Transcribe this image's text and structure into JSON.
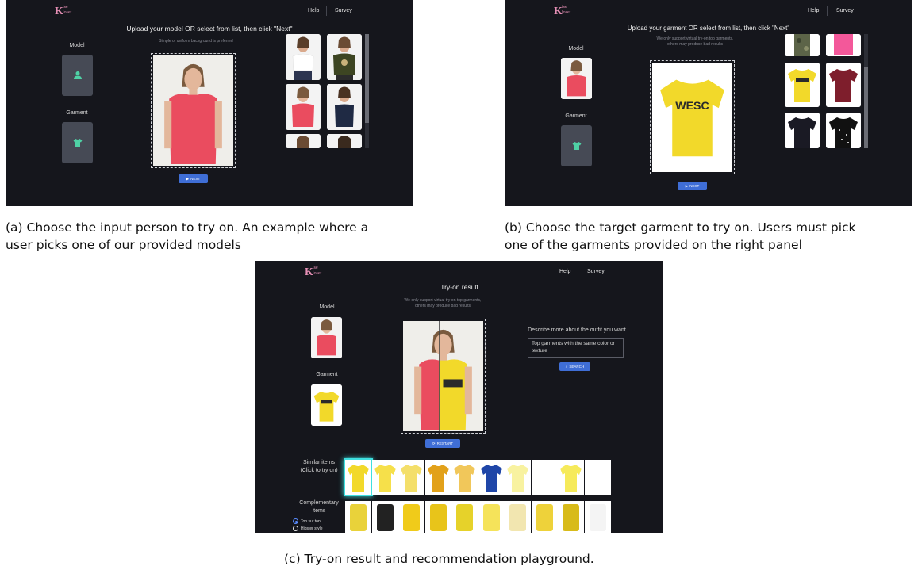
{
  "app": {
    "logo_big": "K",
    "logo_top": "ise",
    "logo_bottom": "loset"
  },
  "nav": {
    "help": "Help",
    "survey": "Survey"
  },
  "panel_a": {
    "title": "Upload your model OR select from list, then click \"Next\"",
    "hint": "Simple or uniform background is preferred",
    "model_label": "Model",
    "garment_label": "Garment",
    "next_label": "NEXT"
  },
  "panel_b": {
    "title": "Upload your garment OR select from list, then click \"Next\"",
    "hint_line1": "We only support virtual try-on top garments,",
    "hint_line2": "others may produce bad results",
    "model_label": "Model",
    "garment_label": "Garment",
    "next_label": "NEXT",
    "garment_print": "WESC"
  },
  "panel_c": {
    "title": "Try-on result",
    "hint_line1": "We only support virtual try-on top garments,",
    "hint_line2": "others may produce bad results",
    "model_label": "Model",
    "garment_label": "Garment",
    "restart_label": "RESTART",
    "describe_label": "Describe more about the outfit you want",
    "describe_value": "Top garments with the same color or texture",
    "search_label": "SEARCH",
    "similar_label_1": "Similar items",
    "similar_label_2": "(Click to try on)",
    "complementary_label_1": "Complementary",
    "complementary_label_2": "items",
    "radio_options": [
      "Ton sur ton",
      "Hipster style"
    ],
    "radio_selected": "Ton sur ton"
  },
  "captions": {
    "a_line1": "(a) Choose the input person to try on. An example where a",
    "a_line2": "user picks one of our provided models",
    "b_line1": "(b) Choose the target garment to try on. Users must pick",
    "b_line2": "one of the garments provided on the right panel",
    "c": "(c) Try-on result and recommendation playground."
  },
  "colors": {
    "background": "#15161c",
    "accent_blue": "#3f6ed6",
    "logo_pink": "#e58fb5",
    "icon_teal": "#4fd1a5",
    "highlight_cyan": "#3fe0e0",
    "coral": "#ea4c5f",
    "yellow": "#f2d92a"
  }
}
